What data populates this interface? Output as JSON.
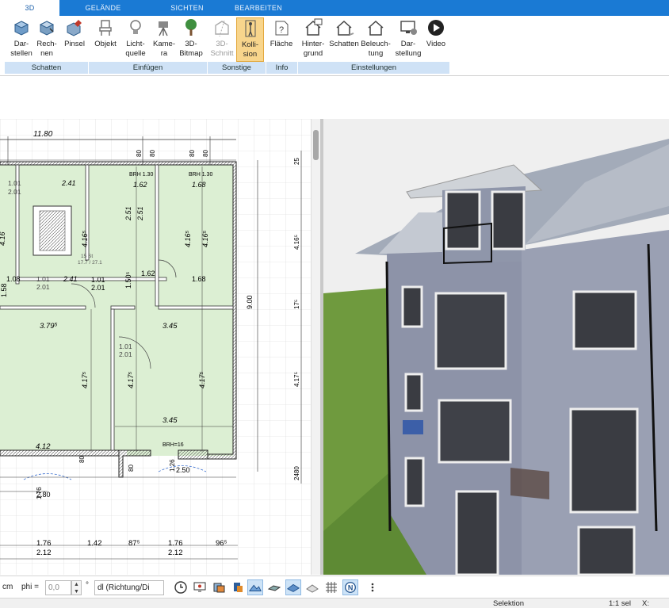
{
  "tabs": [
    {
      "label": "3D",
      "active": true
    },
    {
      "label": "GELÄNDE",
      "active": false
    },
    {
      "label": "SICHTEN",
      "active": false
    },
    {
      "label": "BEARBEITEN",
      "active": false
    }
  ],
  "ribbon": {
    "buttons": {
      "darstellen": "Dar-\nstellen",
      "rechnen": "Rech-\nnen",
      "pinsel": "Pinsel",
      "objekt": "Objekt",
      "lichtquelle": "Licht-\nquelle",
      "kamera": "Kame-\nra",
      "bitmap": "3D-\nBitmap",
      "schnitt": "3D-\nSchnitt",
      "kollision": "Kolli-\nsion",
      "flaeche": "Fläche",
      "hintergrund": "Hinter-\ngrund",
      "schatten": "Schatten",
      "beleuchtung": "Beleuch-\ntung",
      "darstellung": "Dar-\nstellung",
      "video": "Video"
    },
    "groups": {
      "schatten": "Schatten",
      "einfuegen": "Einfügen",
      "sonstige": "Sonstige",
      "info": "Info",
      "einstellungen": "Einstellungen"
    }
  },
  "plan": {
    "dims": {
      "top_total": "11.80",
      "d_241a": "2.41",
      "d_162": "1.62",
      "d_168a": "1.68",
      "d_101a": "1.01",
      "d_201a": "2.01",
      "brh_130a": "BRH 1.30",
      "brh_130b": "BRH 1.30",
      "d_80a": "80",
      "d_80b": "80",
      "d_80c": "80",
      "d_80d": "80",
      "d_251a": "2.51",
      "d_251b": "2.51",
      "d_4165a": "4.16⁵",
      "d_4165b": "4.16⁵",
      "d_4165c": "4.16⁵",
      "d_4165d": "4.16⁵",
      "d_416": "4.16",
      "stair": "15 St",
      "stair2": "17.7 / 27.1",
      "d_101b": "1.01",
      "d_201b": "2.01",
      "d_241b": "2.41",
      "d_101c": "1.01",
      "d_201c": "2.01",
      "d_1505": "1.50⁵",
      "d_162b": "1.62",
      "d_168b": "1.68",
      "d_108": "1.08",
      "d_158": "1.58",
      "d_3795": "3.79⁵",
      "d_345a": "3.45",
      "d_101d": "1.01",
      "d_201d": "2.01",
      "d_4175a": "4.17⁵",
      "d_4175b": "4.17⁵",
      "d_4175c": "4.17⁵",
      "d_345b": "3.45",
      "d_412": "4.12",
      "brh_16": "BRH=16",
      "d_80e": "80",
      "d_80f": "80",
      "d_126": "1.26",
      "d_250": "2.50",
      "d_176a": "1.76",
      "d_280": "2.80",
      "d_900": "9.00",
      "d_25": "25",
      "d_4165e": "4.16⁵",
      "d_175": "17⁵",
      "d_4175d": "4.17⁵",
      "d_2480": "2480",
      "row_176a": "1.76",
      "row_142": "1.42",
      "row_875": "87⁵",
      "row_176b": "1.76",
      "row_965": "96⁵",
      "row_212a": "2.12",
      "row_212b": "2.12"
    }
  },
  "toolbar": {
    "unit": "cm",
    "phi_label": "phi =",
    "phi_value": "0,0",
    "degree": "°",
    "direction": "dl (Richtung/Di"
  },
  "status": {
    "selektion": "Selektion",
    "scale": "1:1 sel",
    "x": "X:"
  },
  "colors": {
    "accent": "#1a7ad4",
    "ribbon_group": "#cfe2f6",
    "highlight": "#f8d58c",
    "room_fill": "#dcefd3"
  }
}
